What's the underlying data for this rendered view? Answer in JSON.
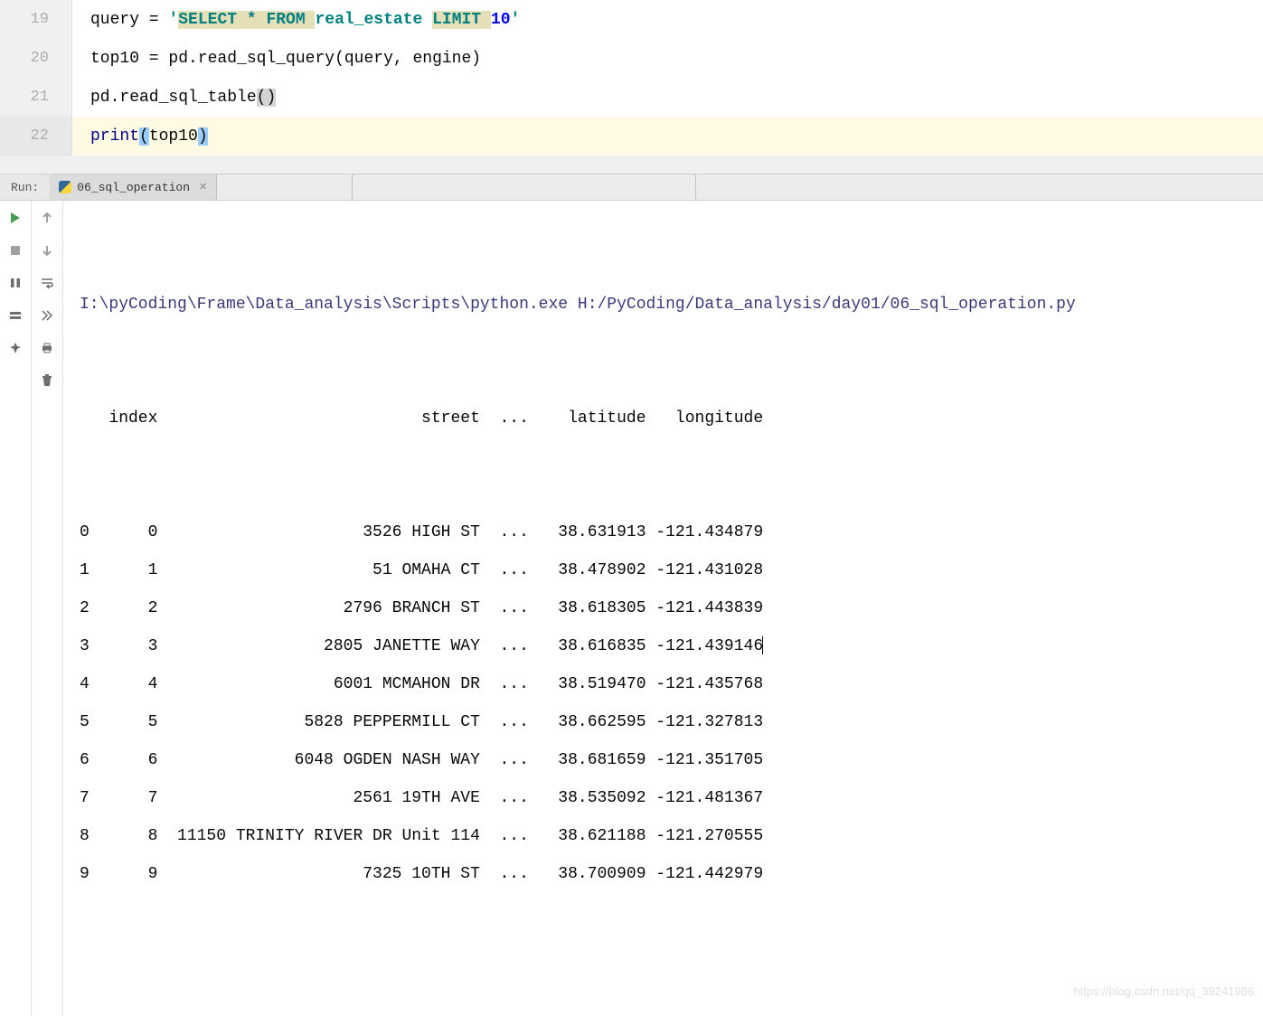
{
  "editor": {
    "lines": [
      {
        "num": "19",
        "tokens": [
          {
            "t": "query = ",
            "cls": ""
          },
          {
            "t": "'",
            "cls": "str-green"
          },
          {
            "t": "SELECT * FROM ",
            "cls": "str-highlight"
          },
          {
            "t": "real_estate ",
            "cls": "str-green"
          },
          {
            "t": "LIMIT ",
            "cls": "str-highlight"
          },
          {
            "t": "10",
            "cls": "str-num"
          },
          {
            "t": "'",
            "cls": "str-green"
          }
        ]
      },
      {
        "num": "20",
        "tokens": [
          {
            "t": "top10 = pd.",
            "cls": ""
          },
          {
            "t": "read_sql_query",
            "cls": ""
          },
          {
            "t": "(query, engine)",
            "cls": ""
          }
        ]
      },
      {
        "num": "21",
        "tokens": [
          {
            "t": "pd.",
            "cls": ""
          },
          {
            "t": "read_sql_table",
            "cls": ""
          },
          {
            "t": "(",
            "cls": "paren-match"
          },
          {
            "t": ")",
            "cls": "paren-match"
          }
        ]
      },
      {
        "num": "22",
        "active": true,
        "tokens": [
          {
            "t": "print",
            "cls": "kw-purple"
          },
          {
            "t": "(",
            "cls": "paren-highlight"
          },
          {
            "t": "top10",
            "cls": ""
          },
          {
            "t": ")",
            "cls": "paren-highlight"
          }
        ]
      }
    ]
  },
  "run": {
    "label": "Run:",
    "tab_name": "06_sql_operation",
    "cmd": "I:\\pyCoding\\Frame\\Data_analysis\\Scripts\\python.exe H:/PyCoding/Data_analysis/day01/06_sql_operation.py",
    "header_line": "   index                           street  ...    latitude   longitude",
    "rows": [
      "0      0                     3526 HIGH ST  ...   38.631913 -121.434879",
      "1      1                      51 OMAHA CT  ...   38.478902 -121.431028",
      "2      2                   2796 BRANCH ST  ...   38.618305 -121.443839",
      "3      3                 2805 JANETTE WAY  ...   38.616835 -121.439146",
      "4      4                  6001 MCMAHON DR  ...   38.519470 -121.435768",
      "5      5               5828 PEPPERMILL CT  ...   38.662595 -121.327813",
      "6      6              6048 OGDEN NASH WAY  ...   38.681659 -121.351705",
      "7      7                    2561 19TH AVE  ...   38.535092 -121.481367",
      "8      8  11150 TRINITY RIVER DR Unit 114  ...   38.621188 -121.270555",
      "9      9                     7325 10TH ST  ...   38.700909 -121.442979"
    ]
  },
  "chart_data": {
    "type": "table",
    "columns": [
      "",
      "index",
      "street",
      "...",
      "latitude",
      "longitude"
    ],
    "rows": [
      [
        "0",
        "0",
        "3526 HIGH ST",
        "...",
        "38.631913",
        "-121.434879"
      ],
      [
        "1",
        "1",
        "51 OMAHA CT",
        "...",
        "38.478902",
        "-121.431028"
      ],
      [
        "2",
        "2",
        "2796 BRANCH ST",
        "...",
        "38.618305",
        "-121.443839"
      ],
      [
        "3",
        "3",
        "2805 JANETTE WAY",
        "...",
        "38.616835",
        "-121.439146"
      ],
      [
        "4",
        "4",
        "6001 MCMAHON DR",
        "...",
        "38.519470",
        "-121.435768"
      ],
      [
        "5",
        "5",
        "5828 PEPPERMILL CT",
        "...",
        "38.662595",
        "-121.327813"
      ],
      [
        "6",
        "6",
        "6048 OGDEN NASH WAY",
        "...",
        "38.681659",
        "-121.351705"
      ],
      [
        "7",
        "7",
        "2561 19TH AVE",
        "...",
        "38.535092",
        "-121.481367"
      ],
      [
        "8",
        "8",
        "11150 TRINITY RIVER DR Unit 114",
        "...",
        "38.621188",
        "-121.270555"
      ],
      [
        "9",
        "9",
        "7325 10TH ST",
        "...",
        "38.700909",
        "-121.442979"
      ]
    ]
  },
  "watermark": "https://blog.csdn.net/qq_39241986"
}
